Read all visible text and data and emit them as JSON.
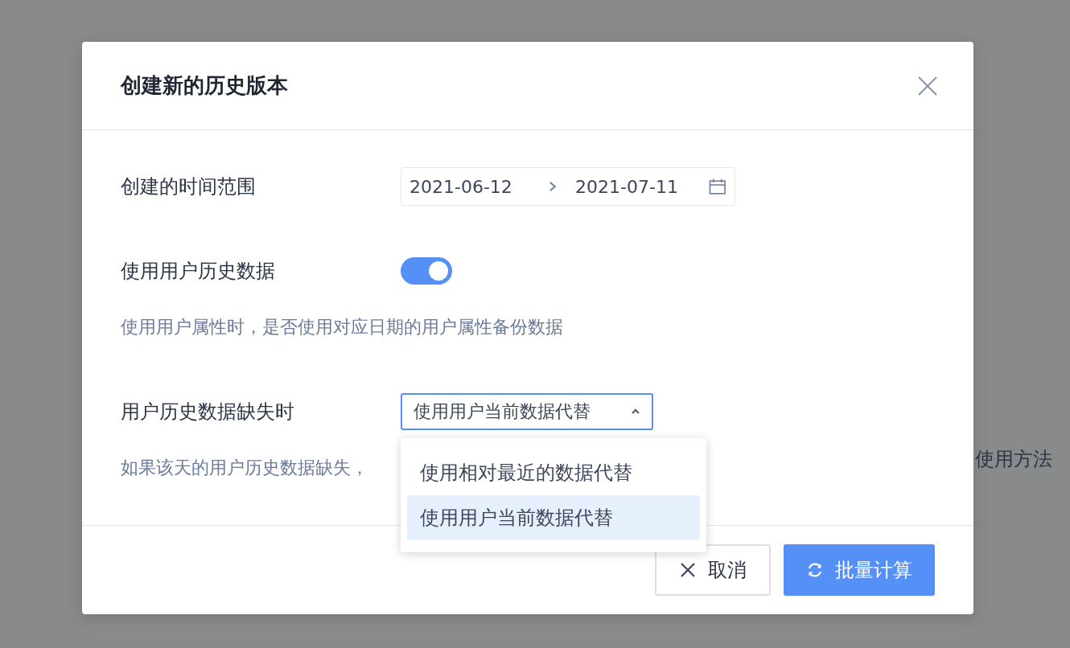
{
  "background": {
    "text": "使用方法"
  },
  "dialog": {
    "title": "创建新的历史版本"
  },
  "form": {
    "date_range": {
      "label": "创建的时间范围",
      "start": "2021-06-12",
      "end": "2021-07-11"
    },
    "history_toggle": {
      "label": "使用用户历史数据",
      "on": true,
      "description": "使用用户属性时，是否使用对应日期的用户属性备份数据"
    },
    "missing_select": {
      "label": "用户历史数据缺失时",
      "value": "使用用户当前数据代替",
      "expanded": true,
      "description": "如果该天的用户历史数据缺失，",
      "options": [
        {
          "label": "使用相对最近的数据代替",
          "selected": false
        },
        {
          "label": "使用用户当前数据代替",
          "selected": true
        }
      ]
    }
  },
  "buttons": [
    {
      "label": "取消",
      "kind": "cancel"
    },
    {
      "label": "批量计算",
      "kind": "primary"
    }
  ]
}
